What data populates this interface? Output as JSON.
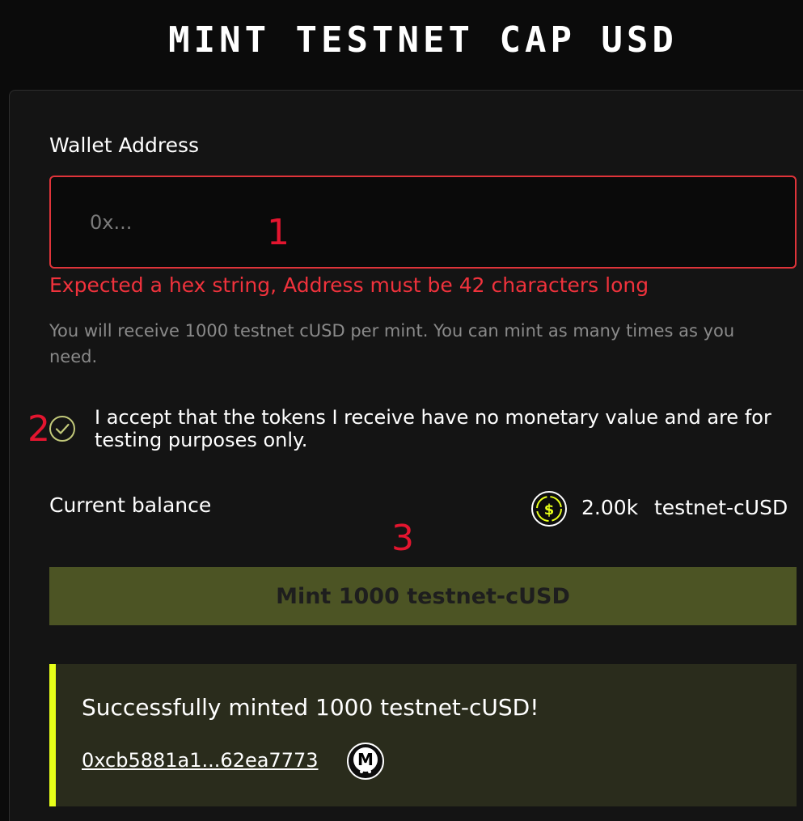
{
  "header": {
    "title": "MINT TESTNET CAP USD"
  },
  "form": {
    "wallet_label": "Wallet Address",
    "wallet_value": "",
    "wallet_placeholder": "0x...",
    "error_text": "Expected a hex string, Address must be 42 characters long",
    "help_text": "You will receive 1000 testnet cUSD per mint. You can mint as many times as you need.",
    "accept_text": "I accept that the tokens I receive have no monetary value and are for testing purposes only.",
    "accept_checked": true
  },
  "balance": {
    "label": "Current balance",
    "amount": "2.00k",
    "unit": "testnet-cUSD",
    "token_icon": "dollar-coin-icon"
  },
  "actions": {
    "mint_label": "Mint 1000 testnet-cUSD"
  },
  "success": {
    "message": "Successfully minted 1000 testnet-cUSD!",
    "tx_hash": "0xcb5881a1...62ea7773",
    "explorer_icon": "explorer-m-icon"
  },
  "annotations": {
    "marker_1": "1",
    "marker_2": "2",
    "marker_3": "3"
  },
  "colors": {
    "background": "#0b0b0b",
    "card": "#141414",
    "error": "#f0323c",
    "accent": "#e7ff19",
    "button": "#4c5424",
    "success_bg": "#2a2c1c",
    "marker": "#e3152f"
  }
}
